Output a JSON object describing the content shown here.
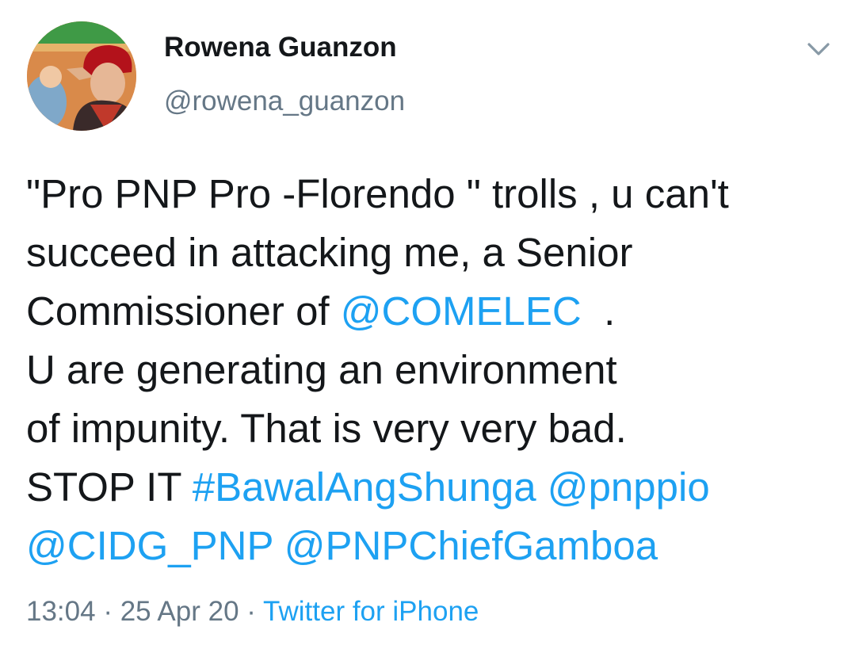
{
  "user": {
    "display_name": "Rowena Guanzon",
    "handle": "@rowena_guanzon"
  },
  "menu": {
    "icon": "chevron-down-icon"
  },
  "tweet": {
    "l1": "\"Pro PNP Pro -Florendo \" trolls , u can't",
    "l2": "succeed in attacking me, a Senior",
    "l3_text": "Commissioner of ",
    "l3_link": "@COMELEC",
    "l3_tail": "  .",
    "l4": "U are generating an environment",
    "l5": "of impunity. That is very very bad.",
    "l6_text": "STOP IT ",
    "hashtag": "#BawalAngShunga",
    "mention_pnppio": "@pnppio",
    "mention_cidg": "@CIDG_PNP",
    "mention_chief": "@PNPChiefGamboa"
  },
  "meta": {
    "time": "13:04",
    "sep1": " · ",
    "date": "25 Apr 20",
    "sep2": " · ",
    "source": "Twitter for iPhone"
  },
  "colors": {
    "link": "#1da1f2",
    "text": "#14171a",
    "secondary": "#657786"
  }
}
